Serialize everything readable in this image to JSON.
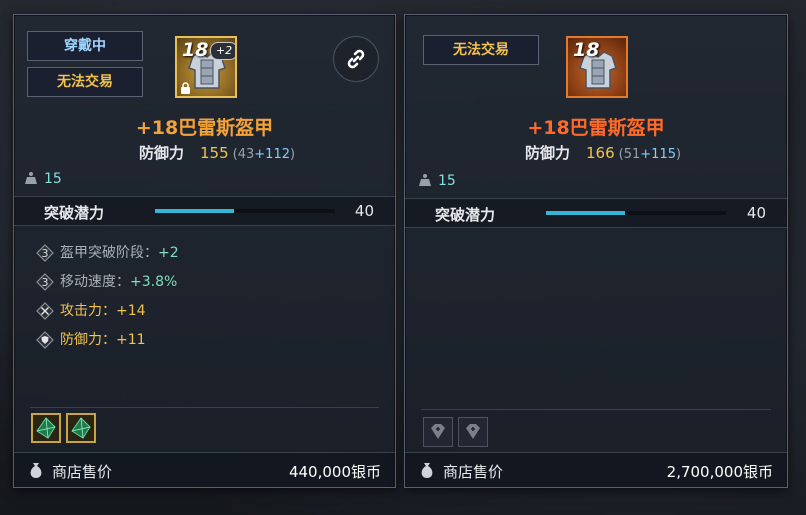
{
  "left": {
    "tags": [
      "穿戴中",
      "无法交易"
    ],
    "enhance_level": "18",
    "enhance_bonus": "+2",
    "item_name": "+18巴雷斯盔甲",
    "stat_label": "防御力",
    "stat_value": "155",
    "stat_base": "(43",
    "stat_add": "+112",
    "stat_close": ")",
    "weight": "15",
    "potential_label": "突破潜力",
    "potential_value": "40",
    "potential_fill_pct": 44,
    "effects": [
      {
        "label": "盔甲突破阶段：",
        "value": "+2",
        "icon": "tier-3-icon",
        "tier": "3"
      },
      {
        "label": "移动速度：",
        "value": "+3.8%",
        "icon": "tier-3-icon",
        "tier": "3"
      },
      {
        "label": "攻击力：",
        "value": "+14",
        "icon": "crossed-swords-icon"
      },
      {
        "label": "防御力：",
        "value": "+11",
        "icon": "shield-icon"
      }
    ],
    "sell_label": "商店售价",
    "sell_price": "440,000银币"
  },
  "right": {
    "tags": [
      "无法交易"
    ],
    "enhance_level": "18",
    "item_name": "+18巴雷斯盔甲",
    "stat_label": "防御力",
    "stat_value": "166",
    "stat_base": "(51",
    "stat_add": "+115",
    "stat_close": ")",
    "weight": "15",
    "potential_label": "突破潜力",
    "potential_value": "40",
    "potential_fill_pct": 44,
    "sell_label": "商店售价",
    "sell_price": "2,700,000银币"
  },
  "colors": {
    "accent_gold": "#f2c14e",
    "accent_cyan": "#31b6d6",
    "name_left": "#f3a23a",
    "name_right": "#ff6a2a"
  }
}
